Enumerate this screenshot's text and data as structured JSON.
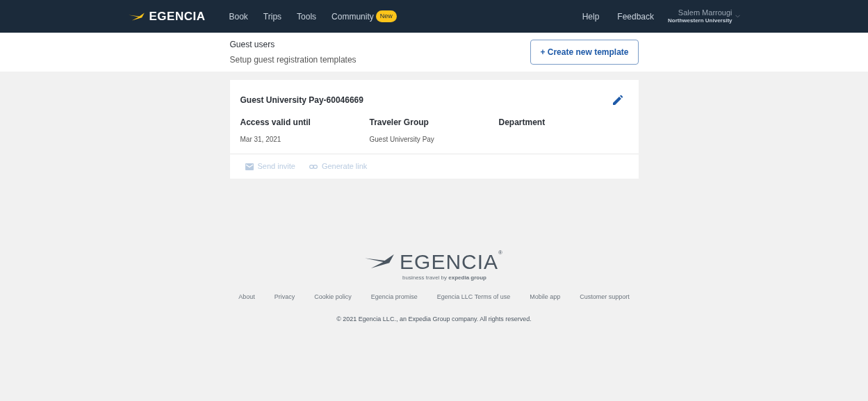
{
  "header": {
    "logo": "EGENCIA",
    "nav": [
      {
        "label": "Book"
      },
      {
        "label": "Trips"
      },
      {
        "label": "Tools"
      },
      {
        "label": "Community",
        "badge": "New"
      }
    ],
    "right": [
      {
        "label": "Help"
      },
      {
        "label": "Feedback"
      }
    ],
    "user": {
      "name": "Salem Marrougi",
      "org": "Northwestern University"
    }
  },
  "page": {
    "title": "Guest users",
    "subtitle": "Setup guest registration templates",
    "create_button": "+ Create new template"
  },
  "templates": [
    {
      "name": "Guest University Pay-60046669",
      "fields": [
        {
          "label": "Access valid until",
          "value": "Mar 31, 2021"
        },
        {
          "label": "Traveler Group",
          "value": "Guest University Pay"
        },
        {
          "label": "Department"
        }
      ],
      "actions": [
        {
          "kind": "invite",
          "label": "Send invite",
          "disabled": true
        },
        {
          "kind": "link",
          "label": "Generate link",
          "disabled": true
        }
      ]
    }
  ],
  "footer": {
    "logo": "EGENCIA$^{®}$",
    "tagline": "business travel by **expedia group**",
    "links": [
      "About",
      "Privacy",
      "Cookie policy",
      "Egencia promise",
      "Egencia LLC Terms of use",
      "Mobile app",
      "Customer support"
    ],
    "copyright": "© 2021 Egencia LLC., an Expedia Group company. All rights reserved."
  }
}
